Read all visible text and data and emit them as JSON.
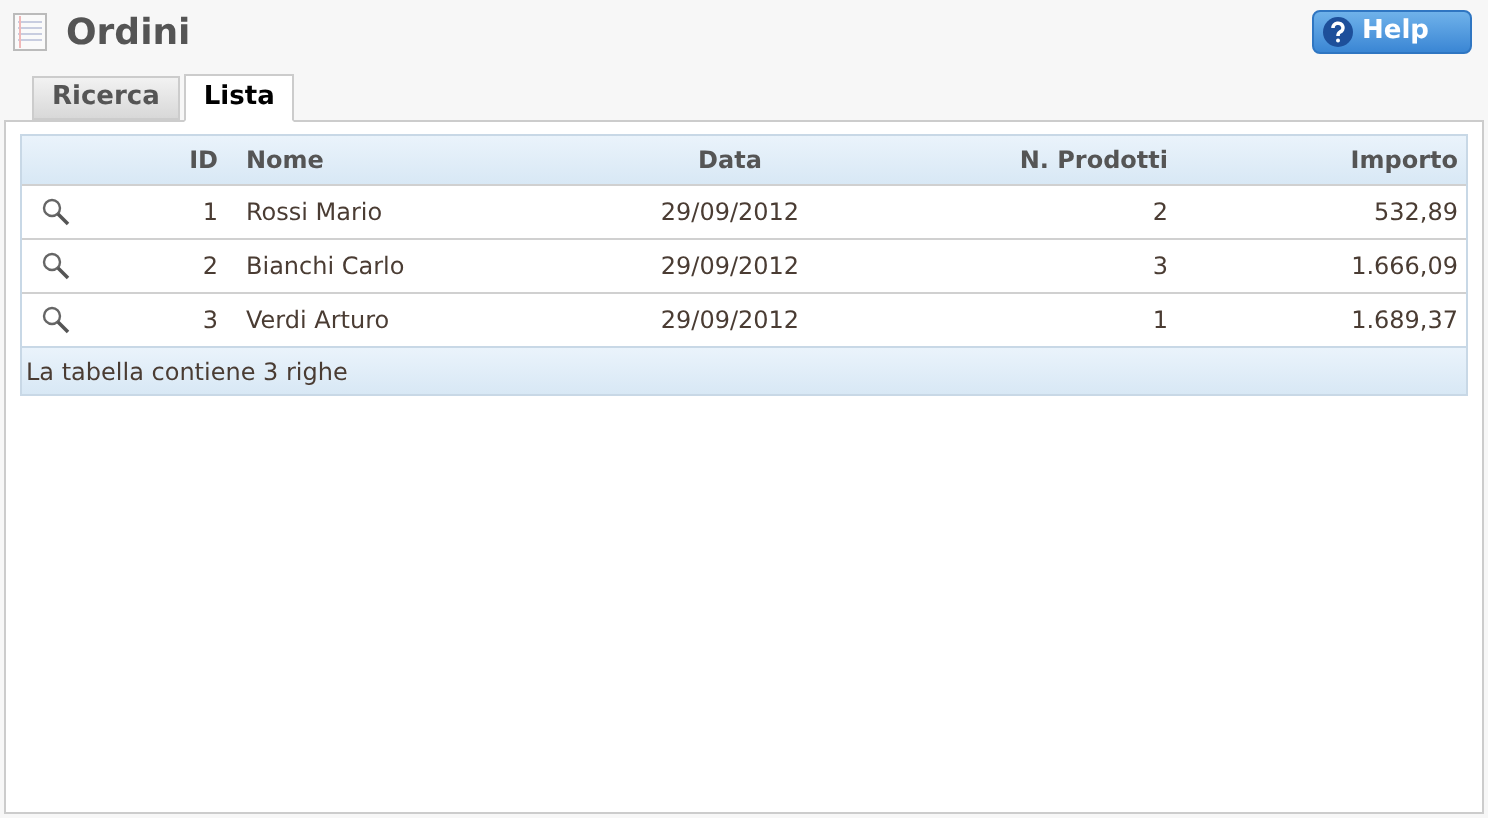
{
  "title": "Ordini",
  "help_button": "Help",
  "tabs": [
    {
      "label": "Ricerca",
      "selected": false
    },
    {
      "label": "Lista",
      "selected": true
    }
  ],
  "table": {
    "columns": [
      "ID",
      "Nome",
      "Data",
      "N. Prodotti",
      "Importo"
    ],
    "rows": [
      [
        "1",
        "Rossi Mario",
        "29/09/2012",
        "2",
        "532,89"
      ],
      [
        "2",
        "Bianchi Carlo",
        "29/09/2012",
        "3",
        "1.666,09"
      ],
      [
        "3",
        "Verdi Arturo",
        "29/09/2012",
        "1",
        "1.689,37"
      ]
    ],
    "footer": "La tabella contiene 3 righe"
  }
}
